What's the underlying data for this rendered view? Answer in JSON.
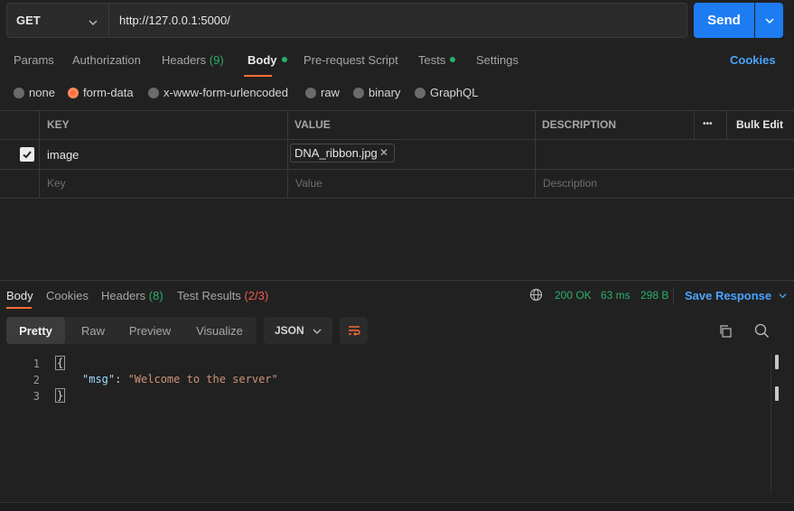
{
  "request": {
    "method": "GET",
    "url": "http://127.0.0.1:5000/",
    "send_label": "Send"
  },
  "tabs": {
    "params": "Params",
    "authorization": "Authorization",
    "headers": "Headers",
    "headers_count": "(9)",
    "body": "Body",
    "pre_request": "Pre-request Script",
    "tests": "Tests",
    "settings": "Settings",
    "cookies": "Cookies"
  },
  "body_types": {
    "none": "none",
    "form_data": "form-data",
    "urlencoded": "x-www-form-urlencoded",
    "raw": "raw",
    "binary": "binary",
    "graphql": "GraphQL",
    "selected": "form-data"
  },
  "form_table": {
    "headers": {
      "key": "KEY",
      "value": "VALUE",
      "description": "DESCRIPTION",
      "more": "•••",
      "bulk_edit": "Bulk Edit"
    },
    "rows": [
      {
        "checked": true,
        "key": "image",
        "value": "DNA_ribbon.jpg",
        "description": ""
      }
    ],
    "placeholders": {
      "key": "Key",
      "value": "Value",
      "description": "Description"
    }
  },
  "response": {
    "tabs": {
      "body": "Body",
      "cookies": "Cookies",
      "headers": "Headers",
      "headers_count": "(8)",
      "test_results": "Test Results",
      "test_results_count": "(2/3)"
    },
    "status": "200 OK",
    "time": "63 ms",
    "size": "298 B",
    "save_response": "Save Response",
    "views": {
      "pretty": "Pretty",
      "raw": "Raw",
      "preview": "Preview",
      "visualize": "Visualize"
    },
    "format": "JSON",
    "lines": [
      "1",
      "2",
      "3"
    ],
    "code": {
      "open": "{",
      "key": "\"msg\"",
      "colon": ": ",
      "value": "\"Welcome to the server\"",
      "close": "}"
    }
  },
  "colors": {
    "accent": "#ff6c37",
    "primary": "#1d7cf2",
    "link": "#4ba3ff",
    "success": "#29b06a",
    "error": "#f05a4f"
  }
}
